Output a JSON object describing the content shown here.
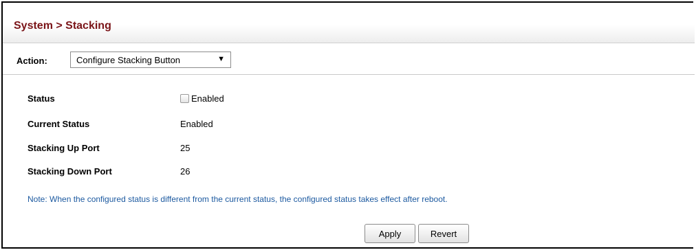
{
  "header": {
    "title": "System > Stacking"
  },
  "action": {
    "label": "Action:",
    "selected": "Configure Stacking Button",
    "arrow_icon": "dropdown-arrow-icon"
  },
  "form": {
    "status": {
      "label": "Status",
      "checkbox_label": "Enabled",
      "checked": false
    },
    "current_status": {
      "label": "Current Status",
      "value": "Enabled"
    },
    "stacking_up_port": {
      "label": "Stacking Up Port",
      "value": "25"
    },
    "stacking_down_port": {
      "label": "Stacking Down Port",
      "value": "26"
    }
  },
  "note": "Note: When the configured status is different from the current status, the configured status takes effect after reboot.",
  "buttons": {
    "apply": "Apply",
    "revert": "Revert"
  },
  "colors": {
    "title": "#7a1418",
    "note": "#1d5aa0"
  }
}
